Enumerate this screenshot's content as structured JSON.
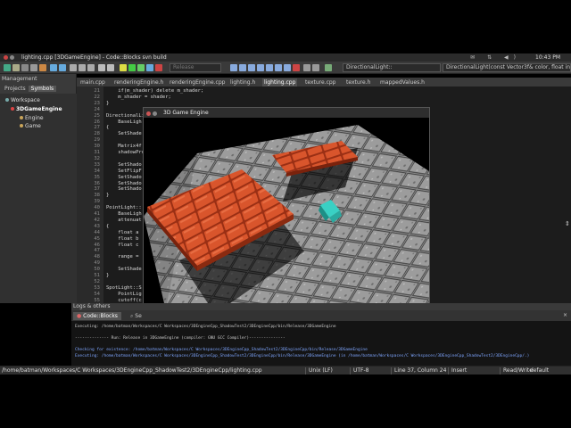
{
  "window": {
    "title": "lighting.cpp [3DGameEngine] - Code::Blocks svn build",
    "time": "10:43 PM"
  },
  "toolbar": {
    "build_target": "Release",
    "symbol_field": "DirectionalLight::",
    "signature_field": "DirectionalLight(const Vector3f& color, float intens"
  },
  "management": {
    "header": "Management",
    "tabs": [
      "Projects",
      "Symbols"
    ],
    "tree": [
      {
        "label": "Workspace",
        "bold": false
      },
      {
        "label": "3DGameEngine",
        "bold": true
      },
      {
        "label": "Engine",
        "bold": false
      },
      {
        "label": "Game",
        "bold": false
      }
    ]
  },
  "editor": {
    "tabs": [
      "main.cpp",
      "renderingEngine.h",
      "renderingEngine.cpp",
      "lighting.h",
      "lighting.cpp",
      "texture.cpp",
      "texture.h",
      "mappedValues.h"
    ],
    "active_tab": 4,
    "lines": [
      {
        "n": "21",
        "code": "    if(m_shader) delete m_shader;"
      },
      {
        "n": "22",
        "code": "    m_shader = shader;"
      },
      {
        "n": "23",
        "code": "}"
      },
      {
        "n": "24",
        "code": ""
      },
      {
        "n": "25",
        "code": "DirectionalLi"
      },
      {
        "n": "26",
        "code": "    BaseLigh"
      },
      {
        "n": "27",
        "code": "{"
      },
      {
        "n": "28",
        "code": "    SetShade"
      },
      {
        "n": "29",
        "code": ""
      },
      {
        "n": "30",
        "code": "    Matrix4f"
      },
      {
        "n": "31",
        "code": "    shadowPro"
      },
      {
        "n": "32",
        "code": ""
      },
      {
        "n": "33",
        "code": "    SetShado"
      },
      {
        "n": "34",
        "code": "    SetFlipF"
      },
      {
        "n": "35",
        "code": "    SetShado"
      },
      {
        "n": "36",
        "code": "    SetShado"
      },
      {
        "n": "37",
        "code": "    SetShado"
      },
      {
        "n": "38",
        "code": "}"
      },
      {
        "n": "39",
        "code": ""
      },
      {
        "n": "40",
        "code": "PointLight::"
      },
      {
        "n": "41",
        "code": "    BaseLigh"
      },
      {
        "n": "42",
        "code": "    attenuat"
      },
      {
        "n": "43",
        "code": "{"
      },
      {
        "n": "44",
        "code": "    float a"
      },
      {
        "n": "45",
        "code": "    float b"
      },
      {
        "n": "46",
        "code": "    float c"
      },
      {
        "n": "47",
        "code": ""
      },
      {
        "n": "48",
        "code": "    range ="
      },
      {
        "n": "49",
        "code": ""
      },
      {
        "n": "50",
        "code": "    SetShade"
      },
      {
        "n": "51",
        "code": "}"
      },
      {
        "n": "52",
        "code": ""
      },
      {
        "n": "53",
        "code": "SpotLight::S"
      },
      {
        "n": "54",
        "code": "    PointLig"
      },
      {
        "n": "55",
        "code": "    cutoff(c"
      }
    ]
  },
  "game_window": {
    "title": "3D Game Engine"
  },
  "logs": {
    "header": "Logs & others",
    "tabs": [
      "Code::Blocks",
      "Se"
    ],
    "lines": [
      {
        "text": "Executing: /home/batman/Workspaces/C Workspaces/3DEngineCpp_ShadowTest2/3DEngineCpp/bin/Release/3DGameEngine",
        "blue": false
      },
      {
        "text": "",
        "blue": false
      },
      {
        "text": "-------------- Run: Release in 3DGameEngine (compiler: GNU GCC Compiler)---------------",
        "blue": false
      },
      {
        "text": "",
        "blue": false
      },
      {
        "text": "Checking for existence: /home/batman/Workspaces/C Workspaces/3DEngineCpp_ShadowTest2/3DEngineCpp/bin/Release/3DGameEngine",
        "blue": true
      },
      {
        "text": "Executing: /home/batman/Workspaces/C Workspaces/3DEngineCpp_ShadowTest2/3DEngineCpp/bin/Release/3DGameEngine  (in /home/batman/Workspaces/C Workspaces/3DEngineCpp_ShadowTest2/3DEngineCpp/.)",
        "blue": true
      }
    ]
  },
  "status": {
    "path": "/home/batman/Workspaces/C Workspaces/3DEngineCpp_ShadowTest2/3DEngineCpp/lighting.cpp",
    "eol": "Unix (LF)",
    "encoding": "UTF-8",
    "position": "Line 37, Column 24",
    "mode": "Insert",
    "access": "Read/Write",
    "profile": "default"
  }
}
